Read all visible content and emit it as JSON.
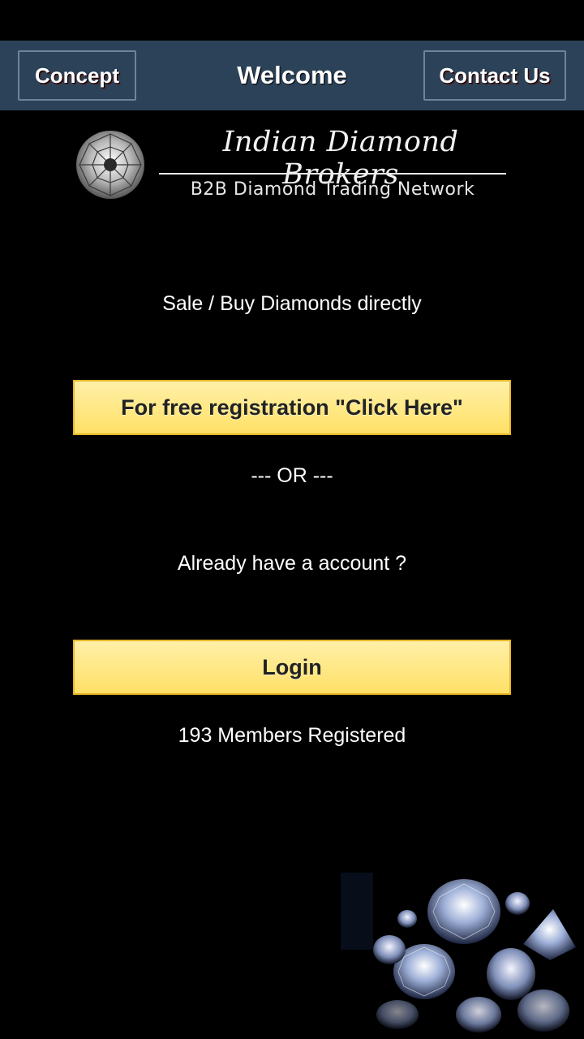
{
  "header": {
    "left_button": "Concept",
    "title": "Welcome",
    "right_button": "Contact Us"
  },
  "logo": {
    "name": "Indian Diamond Brokers",
    "tagline": "B2B Diamond Trading Network",
    "icon": "diamond-icon"
  },
  "main": {
    "intro": "Sale / Buy Diamonds directly",
    "register_button": "For free registration \"Click Here\"",
    "separator": "--- OR ---",
    "account_prompt": "Already have a account ?",
    "login_button": "Login",
    "members_text": "193 Members Registered"
  },
  "colors": {
    "header_bg": "#2c4258",
    "button_yellow": "#ffe066",
    "background": "#000000"
  }
}
